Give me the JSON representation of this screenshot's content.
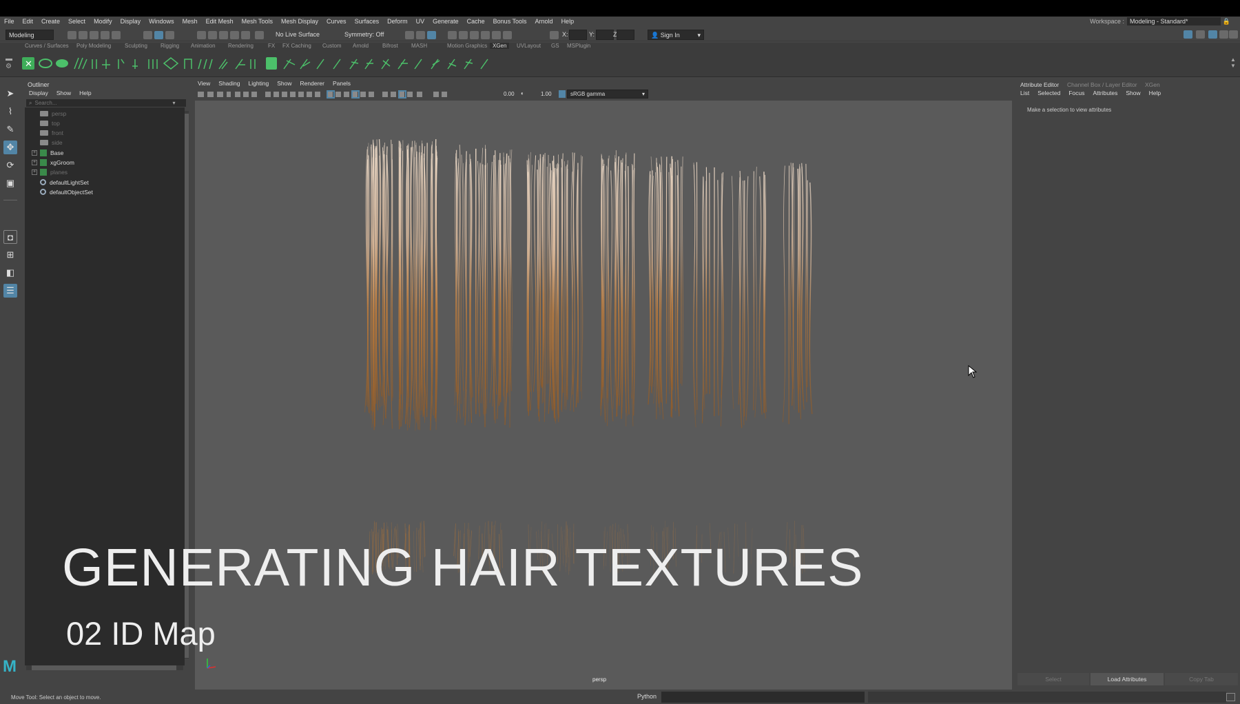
{
  "menus": [
    "File",
    "Edit",
    "Create",
    "Select",
    "Modify",
    "Display",
    "Windows",
    "Mesh",
    "Edit Mesh",
    "Mesh Tools",
    "Mesh Display",
    "Curves",
    "Surfaces",
    "Deform",
    "UV",
    "Generate",
    "Cache",
    "Bonus Tools",
    "Arnold",
    "Help"
  ],
  "workspace": {
    "label": "Workspace :",
    "value": "Modeling - Standard*"
  },
  "status": {
    "mode": "Modeling",
    "live_surface": "No Live Surface",
    "symmetry": "Symmetry: Off",
    "x_label": "X:",
    "y_label": "Y:",
    "z_label": "Z:",
    "sign_in": "Sign In"
  },
  "shelf_tabs": [
    "Curves / Surfaces",
    "Poly Modeling",
    "Sculpting",
    "Rigging",
    "Animation",
    "Rendering",
    "FX",
    "FX Caching",
    "Custom",
    "Arnold",
    "Bifrost",
    "MASH",
    "Motion Graphics",
    "XGen",
    "UVLayout",
    "GS",
    "MSPlugin"
  ],
  "active_shelf": "XGen",
  "outliner": {
    "title": "Outliner",
    "menu": [
      "Display",
      "Show",
      "Help"
    ],
    "search_placeholder": "Search...",
    "items": [
      {
        "label": "persp",
        "type": "camera",
        "dim": true
      },
      {
        "label": "top",
        "type": "camera",
        "dim": true
      },
      {
        "label": "front",
        "type": "camera",
        "dim": true
      },
      {
        "label": "side",
        "type": "camera",
        "dim": true
      },
      {
        "label": "Base",
        "type": "group",
        "dim": false
      },
      {
        "label": "xgGroom",
        "type": "group",
        "dim": false
      },
      {
        "label": "planes",
        "type": "group",
        "dim": true
      },
      {
        "label": "defaultLightSet",
        "type": "set",
        "dim": false
      },
      {
        "label": "defaultObjectSet",
        "type": "set",
        "dim": false
      }
    ]
  },
  "viewport": {
    "menu": [
      "View",
      "Shading",
      "Lighting",
      "Show",
      "Renderer",
      "Panels"
    ],
    "exposure": "0.00",
    "gamma": "1.00",
    "color_space": "sRGB gamma",
    "camera_label": "persp",
    "background": "#5a5a5a"
  },
  "attribute_editor": {
    "tabs": [
      "Attribute Editor",
      "Channel Box / Layer Editor",
      "XGen"
    ],
    "menu": [
      "List",
      "Selected",
      "Focus",
      "Attributes",
      "Show",
      "Help"
    ],
    "message": "Make a selection to view attributes",
    "buttons": [
      "Select",
      "Load Attributes",
      "Copy Tab"
    ]
  },
  "help_line": "Move Tool: Select an object to move.",
  "command_line": {
    "language": "Python"
  },
  "overlay": {
    "title": "GENERATING HAIR TEXTURES",
    "subtitle": "02 ID Map"
  },
  "colors": {
    "accent": "#5285a6",
    "panel": "#444444",
    "field": "#2b2b2b",
    "hair_light": "#e8d6c4",
    "hair_dark": "#b87a3e"
  }
}
